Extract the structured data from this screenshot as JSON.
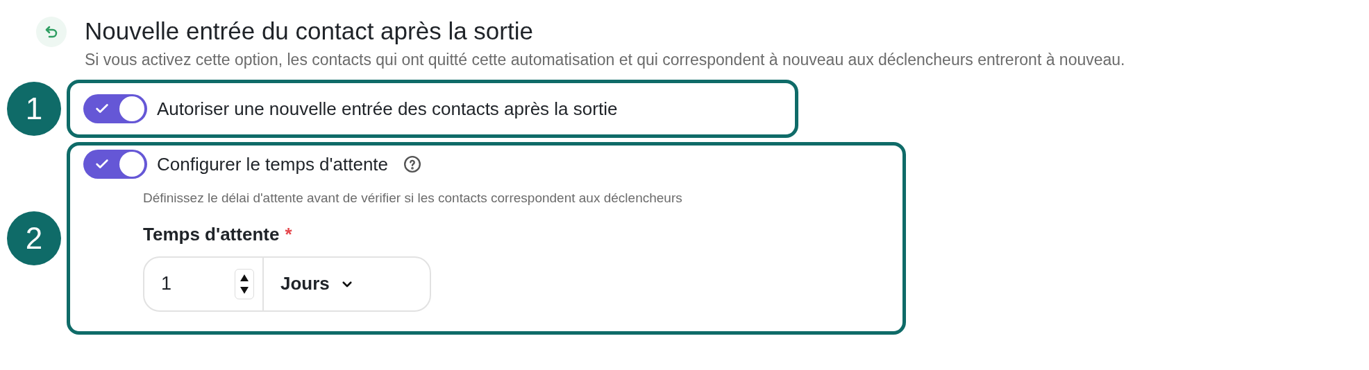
{
  "header": {
    "title": "Nouvelle entrée du contact après la sortie",
    "description": "Si vous activez cette option, les contacts qui ont quitté cette automatisation et qui correspondent à nouveau aux déclencheurs entreront à nouveau."
  },
  "callouts": [
    {
      "number": "1",
      "toggle": {
        "label": "Autoriser une nouvelle entrée des contacts après la sortie",
        "on": true
      }
    },
    {
      "number": "2",
      "toggle": {
        "label": "Configurer le temps d'attente",
        "on": true
      },
      "hint": "Définissez le délai d'attente avant de vérifier si les contacts correspondent aux déclencheurs",
      "field": {
        "label": "Temps d'attente",
        "required": "*",
        "value": "1",
        "unit": "Jours"
      }
    }
  ]
}
